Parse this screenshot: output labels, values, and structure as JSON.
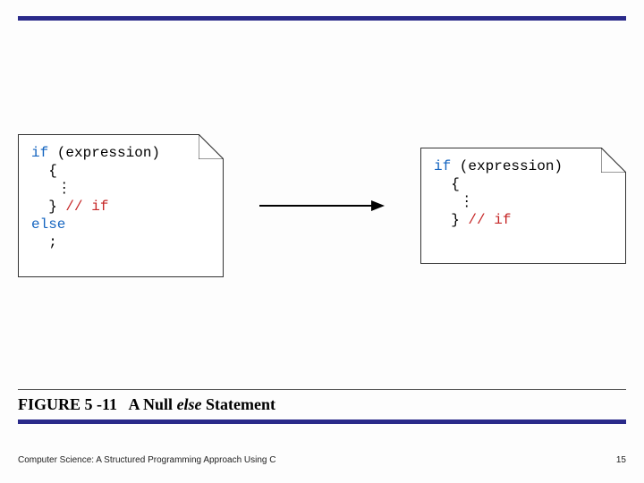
{
  "figure": {
    "label": "FIGURE 5 -11",
    "title_prefix": "A Null ",
    "title_em": "else",
    "title_suffix": " Statement"
  },
  "code_left": {
    "l1a": "if",
    "l1b": " (expression)",
    "l2": "  {",
    "l3": "   ⋮",
    "l4a": "  } ",
    "l4b": "// if",
    "l5": "else",
    "l6": "  ;"
  },
  "code_right": {
    "l1a": "if",
    "l1b": " (expression)",
    "l2": "  {",
    "l3": "   ⋮",
    "l4a": "  } ",
    "l4b": "// if"
  },
  "footer": {
    "left": "Computer Science: A Structured Programming Approach Using C",
    "right": "15"
  }
}
